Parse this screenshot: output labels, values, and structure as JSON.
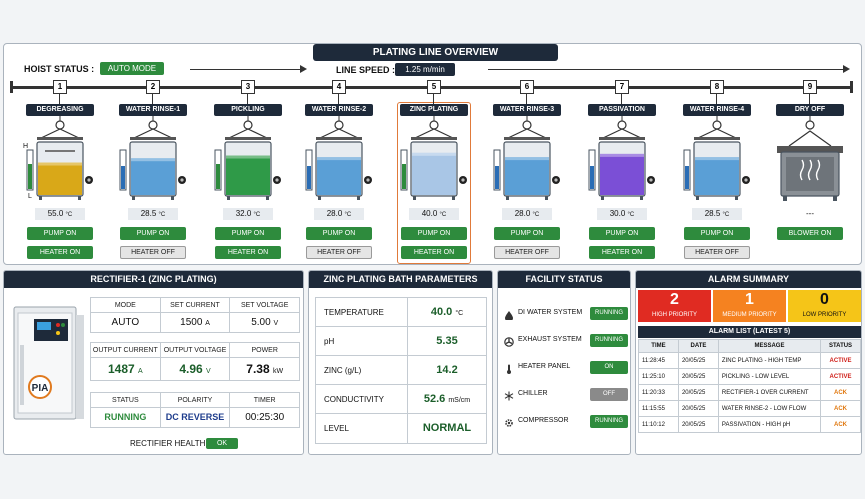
{
  "header": {
    "title": "PLATING LINE OVERVIEW",
    "hoist_label": "HOIST STATUS :",
    "hoist_mode": "AUTO MODE",
    "speed_label": "LINE SPEED :",
    "speed_value": "1.25 m/min"
  },
  "colors": {
    "accent_dark": "#1e2a3a",
    "running_green": "#2e8b3d",
    "high": "#e02b22",
    "medium": "#f58220",
    "low": "#f5c518"
  },
  "stations": [
    {
      "num": "1",
      "name": "DEGREASING",
      "liquid": "#d9a818",
      "level": 0.62,
      "temp": "55.0",
      "unit": "°C",
      "gauge_label": "H",
      "low_label": "L",
      "pump": "PUMP ON",
      "pump_on": true,
      "heater": "HEATER ON",
      "heater_on": true,
      "level_color": "#2e8b3d",
      "hl_level": 0.65
    },
    {
      "num": "2",
      "name": "WATER RINSE-1",
      "liquid": "#5a9fd6",
      "level": 0.7,
      "temp": "28.5",
      "unit": "°C",
      "pump": "PUMP ON",
      "pump_on": true,
      "heater": "HEATER OFF",
      "heater_on": false,
      "level_color": "#2a6db5",
      "hl_level": 0.6
    },
    {
      "num": "3",
      "name": "PICKLING",
      "liquid": "#2f9a48",
      "level": 0.75,
      "temp": "32.0",
      "unit": "°C",
      "pump": "PUMP ON",
      "pump_on": true,
      "heater": "HEATER ON",
      "heater_on": true,
      "level_color": "#2e8b3d",
      "hl_level": 0.65
    },
    {
      "num": "4",
      "name": "WATER RINSE-2",
      "liquid": "#5a9fd6",
      "level": 0.72,
      "temp": "28.0",
      "unit": "°C",
      "pump": "PUMP ON",
      "pump_on": true,
      "heater": "HEATER OFF",
      "heater_on": false,
      "level_color": "#2a6db5",
      "hl_level": 0.6
    },
    {
      "num": "5",
      "name": "ZINC PLATING",
      "liquid": "#a9c6e6",
      "level": 0.8,
      "temp": "40.0",
      "unit": "°C",
      "pump": "PUMP ON",
      "pump_on": true,
      "heater": "HEATER ON",
      "heater_on": true,
      "level_color": "#2e8b3d",
      "hl_level": 0.65
    },
    {
      "num": "6",
      "name": "WATER RINSE-3",
      "liquid": "#5a9fd6",
      "level": 0.72,
      "temp": "28.0",
      "unit": "°C",
      "pump": "PUMP ON",
      "pump_on": true,
      "heater": "HEATER OFF",
      "heater_on": false,
      "level_color": "#2a6db5",
      "hl_level": 0.6
    },
    {
      "num": "7",
      "name": "PASSIVATION",
      "liquid": "#7b4fd6",
      "level": 0.78,
      "temp": "30.0",
      "unit": "°C",
      "pump": "PUMP ON",
      "pump_on": true,
      "heater": "HEATER ON",
      "heater_on": true,
      "level_color": "#2a6db5",
      "hl_level": 0.6
    },
    {
      "num": "8",
      "name": "WATER RINSE-4",
      "liquid": "#5a9fd6",
      "level": 0.72,
      "temp": "28.5",
      "unit": "°C",
      "pump": "PUMP ON",
      "pump_on": true,
      "heater": "HEATER OFF",
      "heater_on": false,
      "level_color": "#2a6db5",
      "hl_level": 0.6
    },
    {
      "num": "9",
      "name": "DRY OFF",
      "dry": true,
      "temp": "---",
      "unit": "",
      "pump": "BLOWER ON",
      "pump_on": true
    }
  ],
  "rectifier": {
    "title": "RECTIFIER-1 (ZINC PLATING)",
    "mode_label": "MODE",
    "mode": "AUTO",
    "set_current_label": "SET CURRENT",
    "set_current": "1500",
    "set_current_unit": "A",
    "set_voltage_label": "SET VOLTAGE",
    "set_voltage": "5.00",
    "set_voltage_unit": "V",
    "out_current_label": "OUTPUT CURRENT",
    "out_current": "1487",
    "out_current_unit": "A",
    "out_voltage_label": "OUTPUT VOLTAGE",
    "out_voltage": "4.96",
    "out_voltage_unit": "V",
    "power_label": "POWER",
    "power": "7.38",
    "power_unit": "kW",
    "status_label": "STATUS",
    "status": "RUNNING",
    "polarity_label": "POLARITY",
    "polarity": "DC REVERSE",
    "timer_label": "TIMER",
    "timer": "00:25:30",
    "health_label": "RECTIFIER HEALTH",
    "health": "OK",
    "logo": "PIA"
  },
  "bath": {
    "title": "ZINC PLATING BATH PARAMETERS",
    "rows": [
      {
        "k": "TEMPERATURE",
        "v": "40.0",
        "u": "°C"
      },
      {
        "k": "pH",
        "v": "5.35",
        "u": ""
      },
      {
        "k": "ZINC (g/L)",
        "v": "14.2",
        "u": ""
      },
      {
        "k": "CONDUCTIVITY",
        "v": "52.6",
        "u": "mS/cm"
      },
      {
        "k": "LEVEL",
        "v": "NORMAL",
        "u": ""
      }
    ]
  },
  "facility": {
    "title": "FACILITY STATUS",
    "items": [
      {
        "name": "DI WATER SYSTEM",
        "status": "RUNNING",
        "on": true,
        "icon": "water-drop-icon"
      },
      {
        "name": "EXHAUST SYSTEM",
        "status": "RUNNING",
        "on": true,
        "icon": "fan-icon"
      },
      {
        "name": "HEATER PANEL",
        "status": "ON",
        "on": true,
        "icon": "thermometer-icon"
      },
      {
        "name": "CHILLER",
        "status": "OFF",
        "on": false,
        "icon": "snowflake-icon"
      },
      {
        "name": "COMPRESSOR",
        "status": "RUNNING",
        "on": true,
        "icon": "gear-icon"
      }
    ]
  },
  "alarms": {
    "title": "ALARM SUMMARY",
    "high": "2",
    "high_label": "HIGH PRIORITY",
    "medium": "1",
    "medium_label": "MEDIUM PRIORITY",
    "low": "0",
    "low_label": "LOW PRIORITY",
    "list_title": "ALARM LIST (LATEST 5)",
    "cols": [
      "TIME",
      "DATE",
      "MESSAGE",
      "STATUS"
    ],
    "rows": [
      {
        "time": "11:28:45",
        "date": "20/05/25",
        "msg": "ZINC PLATING - HIGH TEMP",
        "status": "ACTIVE",
        "color": "#d0201a"
      },
      {
        "time": "11:25:10",
        "date": "20/05/25",
        "msg": "PICKLING - LOW LEVEL",
        "status": "ACTIVE",
        "color": "#d0201a"
      },
      {
        "time": "11:20:33",
        "date": "20/05/25",
        "msg": "RECTIFIER-1 OVER CURRENT",
        "status": "ACK",
        "color": "#e0780f"
      },
      {
        "time": "11:15:55",
        "date": "20/05/25",
        "msg": "WATER RINSE-2 - LOW FLOW",
        "status": "ACK",
        "color": "#e0780f"
      },
      {
        "time": "11:10:12",
        "date": "20/05/25",
        "msg": "PASSIVATION - HIGH pH",
        "status": "ACK",
        "color": "#e0780f"
      }
    ]
  }
}
